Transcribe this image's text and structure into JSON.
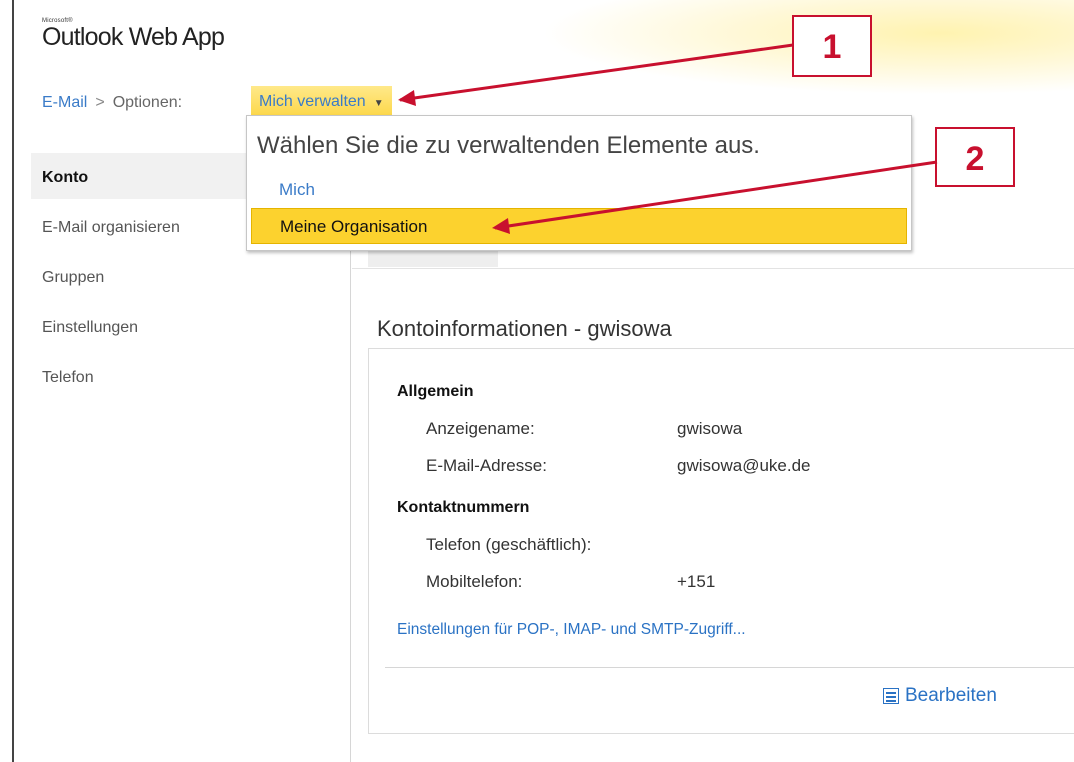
{
  "app": {
    "brand_small": "Microsoft®",
    "title": "Outlook Web App"
  },
  "breadcrumb": {
    "email": "E-Mail",
    "separator": ">",
    "options": "Optionen:",
    "dropdown": "Mich verwalten"
  },
  "popup": {
    "title": "Wählen Sie die zu verwaltenden Elemente aus.",
    "items": [
      {
        "label": "Mich"
      },
      {
        "label": "Meine Organisation",
        "selected": true
      }
    ]
  },
  "nav": {
    "items": [
      {
        "label": "Konto",
        "active": true
      },
      {
        "label": "E-Mail organisieren"
      },
      {
        "label": "Gruppen"
      },
      {
        "label": "Einstellungen"
      },
      {
        "label": "Telefon"
      }
    ]
  },
  "content": {
    "title": "Kontoinformationen - gwisowa",
    "general": {
      "heading": "Allgemein",
      "display_name_label": "Anzeigename:",
      "display_name_value": "gwisowa",
      "email_label": "E-Mail-Adresse:",
      "email_value": "gwisowa@uke.de"
    },
    "contact": {
      "heading": "Kontaktnummern",
      "business_phone_label": "Telefon (geschäftlich):",
      "business_phone_value": "",
      "mobile_label": "Mobiltelefon:",
      "mobile_value": "+151"
    },
    "pop_link": "Einstellungen für POP-, IMAP- und SMTP-Zugriff...",
    "edit_label": "Bearbeiten"
  },
  "annotations": {
    "callout1": "1",
    "callout2": "2",
    "arrow_color": "#c8102e"
  },
  "colors": {
    "accent_yellow": "#fcd22e",
    "link_blue": "#3a7bc8"
  }
}
